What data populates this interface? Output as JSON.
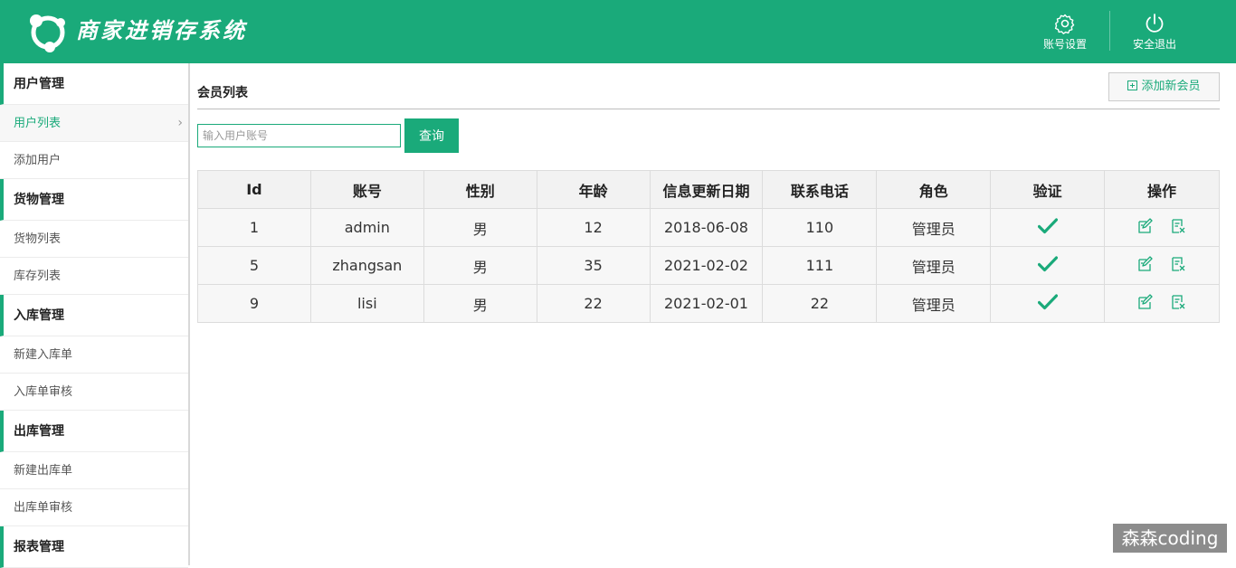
{
  "header": {
    "app_title": "商家进销存系统",
    "account_settings_label": "账号设置",
    "logout_label": "安全退出"
  },
  "sidebar": {
    "groups": [
      {
        "label": "用户管理",
        "items": [
          {
            "label": "用户列表",
            "active": true
          },
          {
            "label": "添加用户"
          }
        ]
      },
      {
        "label": "货物管理",
        "items": [
          {
            "label": "货物列表"
          },
          {
            "label": "库存列表"
          }
        ]
      },
      {
        "label": "入库管理",
        "items": [
          {
            "label": "新建入库单"
          },
          {
            "label": "入库单审核"
          }
        ]
      },
      {
        "label": "出库管理",
        "items": [
          {
            "label": "新建出库单"
          },
          {
            "label": "出库单审核"
          }
        ]
      },
      {
        "label": "报表管理",
        "items": []
      }
    ]
  },
  "main": {
    "page_title": "会员列表",
    "add_button_label": "添加新会员",
    "search": {
      "placeholder": "输入用户账号",
      "value": "",
      "button_label": "查询"
    },
    "table": {
      "headers": [
        "Id",
        "账号",
        "性别",
        "年龄",
        "信息更新日期",
        "联系电话",
        "角色",
        "验证",
        "操作"
      ],
      "rows": [
        {
          "id": "1",
          "account": "admin",
          "gender": "男",
          "age": "12",
          "updated": "2018-06-08",
          "phone": "110",
          "role": "管理员",
          "verified": true
        },
        {
          "id": "5",
          "account": "zhangsan",
          "gender": "男",
          "age": "35",
          "updated": "2021-02-02",
          "phone": "111",
          "role": "管理员",
          "verified": true
        },
        {
          "id": "9",
          "account": "lisi",
          "gender": "男",
          "age": "22",
          "updated": "2021-02-01",
          "phone": "22",
          "role": "管理员",
          "verified": true
        }
      ]
    }
  },
  "watermark": "森森coding",
  "colors": {
    "brand": "#1aaa7a"
  }
}
